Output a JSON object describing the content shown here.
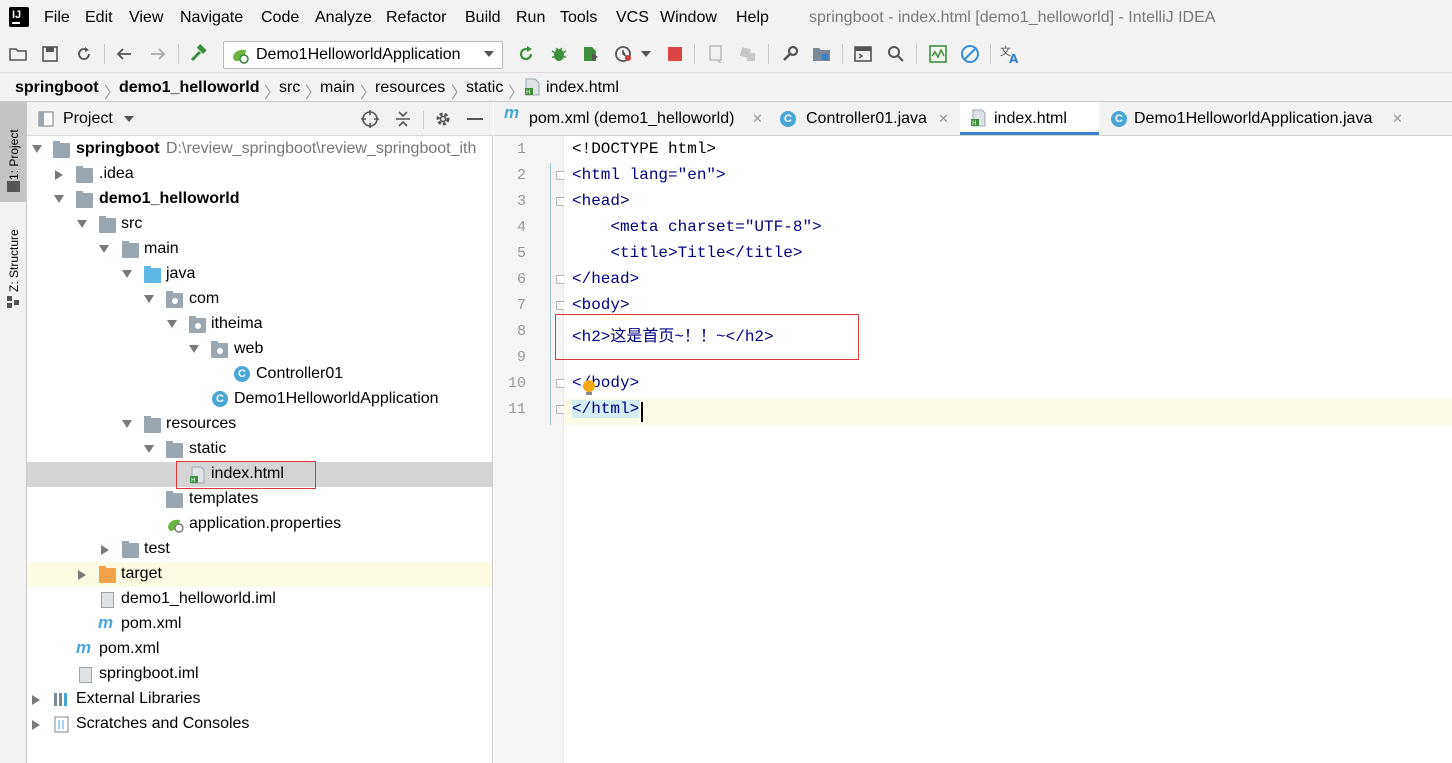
{
  "window": {
    "title": "springboot - index.html [demo1_helloworld] - IntelliJ IDEA",
    "logo_text": "IJ"
  },
  "menu": [
    "File",
    "Edit",
    "View",
    "Navigate",
    "Code",
    "Analyze",
    "Refactor",
    "Build",
    "Run",
    "Tools",
    "VCS",
    "Window",
    "Help"
  ],
  "toolbar": {
    "run_config": "Demo1HelloworldApplication",
    "icons": [
      "folder-open-icon",
      "save-icon",
      "sync-icon",
      "back-icon",
      "forward-icon",
      "build-hammer-icon",
      "run-icon",
      "debug-icon",
      "coverage-icon",
      "profile-icon",
      "stop-icon",
      "device-icon",
      "deploy-icon",
      "settings-wrench-icon",
      "project-structure-icon",
      "terminal-icon",
      "search-icon",
      "monitor-icon",
      "disable-icon",
      "translate-icon"
    ]
  },
  "breadcrumb": [
    "springboot",
    "demo1_helloworld",
    "src",
    "main",
    "resources",
    "static",
    "index.html"
  ],
  "side_strip": {
    "project": "1: Project",
    "structure": "Z: Structure"
  },
  "project_panel": {
    "title": "Project",
    "tree": [
      {
        "label": "springboot",
        "path": "D:\\review_springboot\\review_springboot_ith",
        "bold": true
      },
      {
        "label": ".idea"
      },
      {
        "label": "demo1_helloworld",
        "bold": true
      },
      {
        "label": "src"
      },
      {
        "label": "main"
      },
      {
        "label": "java"
      },
      {
        "label": "com"
      },
      {
        "label": "itheima"
      },
      {
        "label": "web"
      },
      {
        "label": "Controller01"
      },
      {
        "label": "Demo1HelloworldApplication"
      },
      {
        "label": "resources"
      },
      {
        "label": "static"
      },
      {
        "label": "index.html",
        "selected": true
      },
      {
        "label": "templates"
      },
      {
        "label": "application.properties"
      },
      {
        "label": "test"
      },
      {
        "label": "target"
      },
      {
        "label": "demo1_helloworld.iml"
      },
      {
        "label": "pom.xml"
      },
      {
        "label": "pom.xml"
      },
      {
        "label": "springboot.iml"
      },
      {
        "label": "External Libraries"
      },
      {
        "label": "Scratches and Consoles"
      }
    ]
  },
  "tabs": [
    {
      "label": "pom.xml (demo1_helloworld)",
      "icon": "maven-icon"
    },
    {
      "label": "Controller01.java",
      "icon": "class-icon"
    },
    {
      "label": "index.html",
      "icon": "html-file-icon",
      "active": true
    },
    {
      "label": "Demo1HelloworldApplication.java",
      "icon": "spring-class-icon"
    }
  ],
  "close_glyph": "✕",
  "editor": {
    "line_numbers": [
      "1",
      "2",
      "3",
      "4",
      "5",
      "6",
      "7",
      "8",
      "9",
      "10",
      "11"
    ],
    "lines": [
      "<!DOCTYPE html>",
      "<html lang=\"en\">",
      "<head>",
      "    <meta charset=\"UTF-8\">",
      "    <title>Title</title>",
      "</head>",
      "<body>",
      "<h2>这是首页~！！~</h2>",
      "",
      "</body>",
      "</html>"
    ]
  }
}
